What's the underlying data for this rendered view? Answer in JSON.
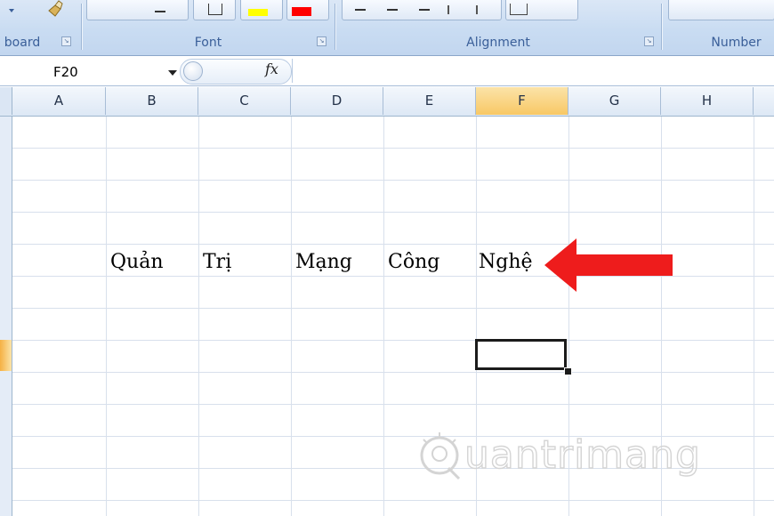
{
  "ribbon": {
    "groups": [
      {
        "label": "board"
      },
      {
        "label": "Font"
      },
      {
        "label": "Alignment"
      },
      {
        "label": "Number"
      }
    ],
    "colors": {
      "highlight": "#ffff00",
      "font_color": "#ff0000"
    }
  },
  "formula_bar": {
    "name_box": "F20",
    "fx_label": "fx",
    "formula": ""
  },
  "columns": [
    "A",
    "B",
    "C",
    "D",
    "E",
    "F",
    "G",
    "H"
  ],
  "selected_column": "F",
  "cells": [
    {
      "ref": "B",
      "text": "Quản"
    },
    {
      "ref": "C",
      "text": "Trị"
    },
    {
      "ref": "D",
      "text": "Mạng"
    },
    {
      "ref": "E",
      "text": "Công"
    },
    {
      "ref": "F",
      "text": "Nghệ"
    }
  ],
  "annotation": {
    "arrow_color": "#ee1c1c"
  },
  "watermark": {
    "text": "uantrimang"
  }
}
